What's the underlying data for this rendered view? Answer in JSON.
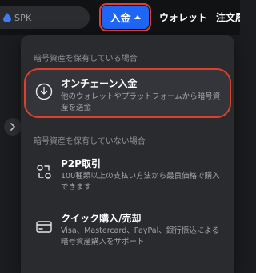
{
  "header": {
    "search_pill_text": "SPK",
    "deposit_label": "入金",
    "nav_wallet": "ウォレット",
    "nav_orders": "注文履"
  },
  "dropdown": {
    "section_have_crypto": "暗号資産を保有している場合",
    "section_no_crypto": "暗号資産を保有していない場合",
    "items": [
      {
        "title": "オンチェーン入金",
        "desc": "他のウォレットやプラットフォームから暗号資産を送金",
        "icon": "download-circle-icon"
      },
      {
        "title": "P2P取引",
        "desc": "100種類以上の支払い方法から最良価格で購入できます",
        "icon": "p2p-exchange-icon"
      },
      {
        "title": "クイック購入/売却",
        "desc": "Visa、Mastercard、PayPal、銀行振込による暗号資産購入をサポート",
        "icon": "card-icon"
      }
    ]
  },
  "colors": {
    "accent": "#1e66f5",
    "highlight": "#e0402b",
    "panel": "#2a2b2e",
    "topbar": "#111214"
  }
}
